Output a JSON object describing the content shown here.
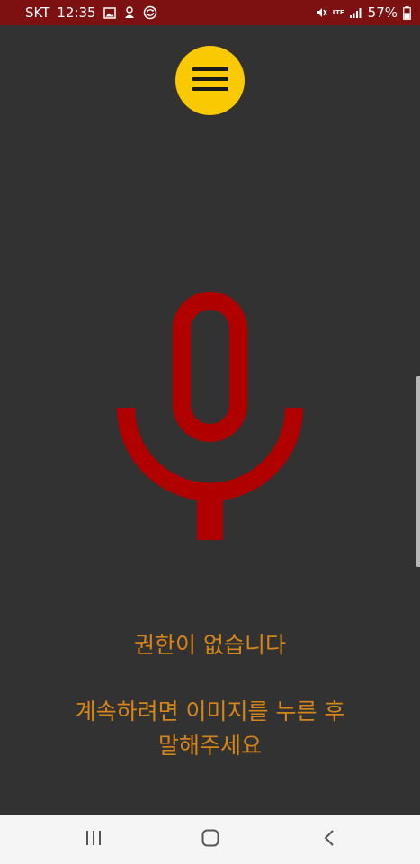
{
  "status_bar": {
    "carrier": "SKT",
    "time": "12:35",
    "network_type": "LTE",
    "battery_percent": "57%",
    "battery_level": 0.57,
    "icons": [
      "gallery-icon",
      "app-notification-icon",
      "sync-icon",
      "mute-icon",
      "lte-icon",
      "signal-icon",
      "battery-icon"
    ]
  },
  "menu_button": {
    "icon": "hamburger-menu-icon",
    "color": "#fbc900"
  },
  "microphone": {
    "icon": "microphone-icon",
    "color": "#b00000"
  },
  "messages": {
    "no_permission": "권한이 없습니다",
    "instruction_line1": "계속하려면 이미지를 누른 후",
    "instruction_line2": "말해주세요",
    "color": "#d68619"
  },
  "nav_bar": {
    "recent_icon": "recent-apps-icon",
    "home_icon": "home-icon",
    "back_icon": "back-icon"
  }
}
